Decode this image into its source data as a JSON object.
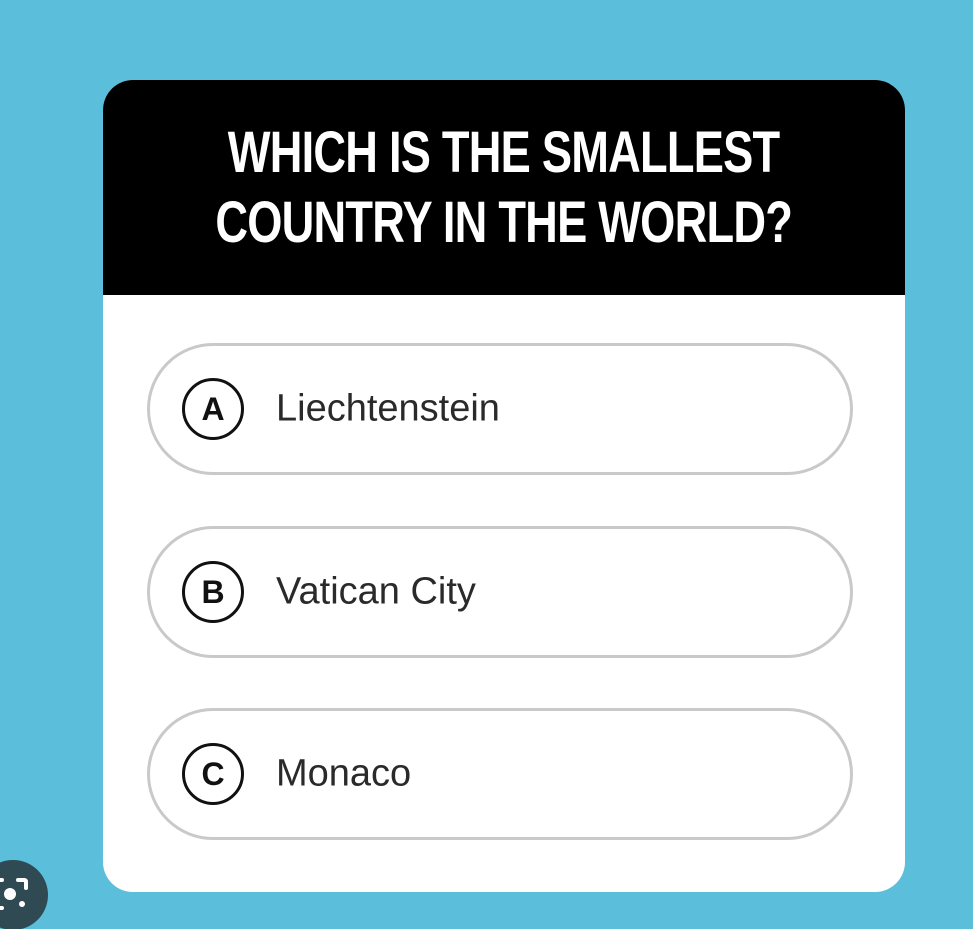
{
  "question": {
    "line_1": "WHICH IS THE SMALLEST",
    "line_2": "COUNTRY IN THE WORLD?"
  },
  "options": [
    {
      "letter": "A",
      "text": "Liechtenstein"
    },
    {
      "letter": "B",
      "text": "Vatican City"
    },
    {
      "letter": "C",
      "text": "Monaco"
    }
  ],
  "icons": {
    "corner_button": "image-search-lens-icon"
  },
  "colors": {
    "background": "#5bbfdc",
    "header": "#000000",
    "card": "#ffffff",
    "option_border": "#c9c9c9"
  }
}
